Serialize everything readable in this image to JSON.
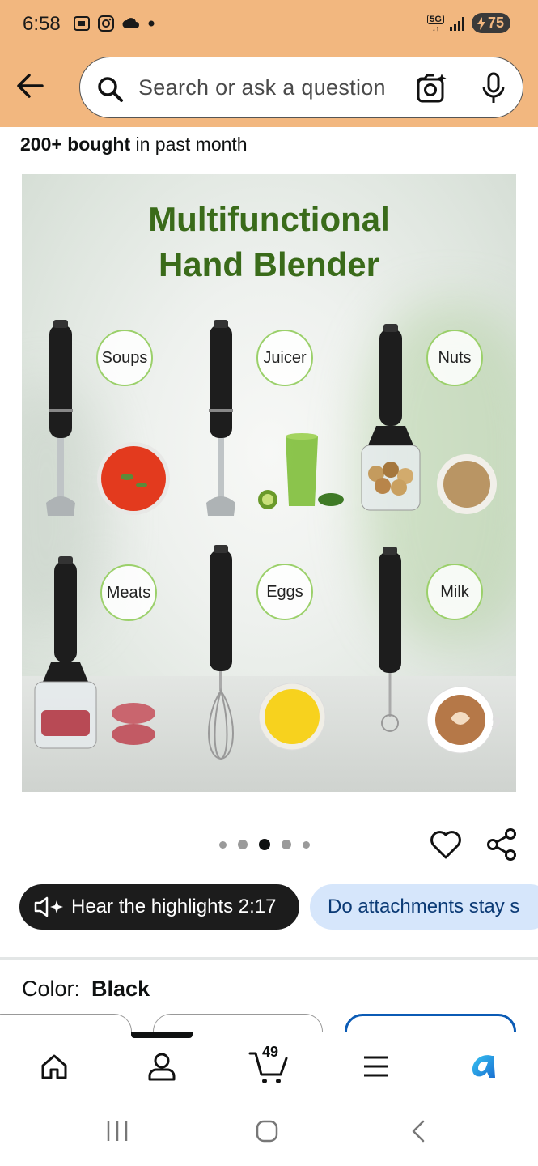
{
  "status_bar": {
    "time": "6:58",
    "network": "5G",
    "battery": "75",
    "icons_left": [
      "screenshot-icon",
      "instagram-icon",
      "cloud-icon",
      "dot-icon"
    ]
  },
  "header": {
    "search_placeholder": "Search or ask a question",
    "icons": [
      "back-arrow-icon",
      "search-icon",
      "camera-lens-icon",
      "microphone-icon"
    ]
  },
  "product": {
    "bought_bold": "200+ bought",
    "bought_rest": " in past month",
    "image": {
      "title_line1": "Multifunctional",
      "title_line2": "Hand Blender",
      "tags": [
        "Soups",
        "Juicer",
        "Nuts",
        "Meats",
        "Eggs",
        "Milk"
      ]
    },
    "carousel": {
      "count": 5,
      "active_index": 2
    }
  },
  "actions": {
    "hear_highlights": "Hear the highlights 2:17",
    "question_pill": "Do attachments stay s"
  },
  "color": {
    "label": "Color:",
    "value": "Black"
  },
  "bottom_nav": {
    "items": [
      "home-icon",
      "account-icon",
      "cart-icon",
      "menu-icon",
      "rufus-icon"
    ],
    "cart_count": "49",
    "active_index": 1
  },
  "colors": {
    "header_bg": "#f2b77f",
    "title_green": "#3a6b1a",
    "tag_border": "#9bd06a",
    "pill_dark": "#1c1c1c",
    "pill_light": "#d6e6fb",
    "selected_swatch": "#0b5bb5",
    "rufus": "#1a9be0"
  }
}
